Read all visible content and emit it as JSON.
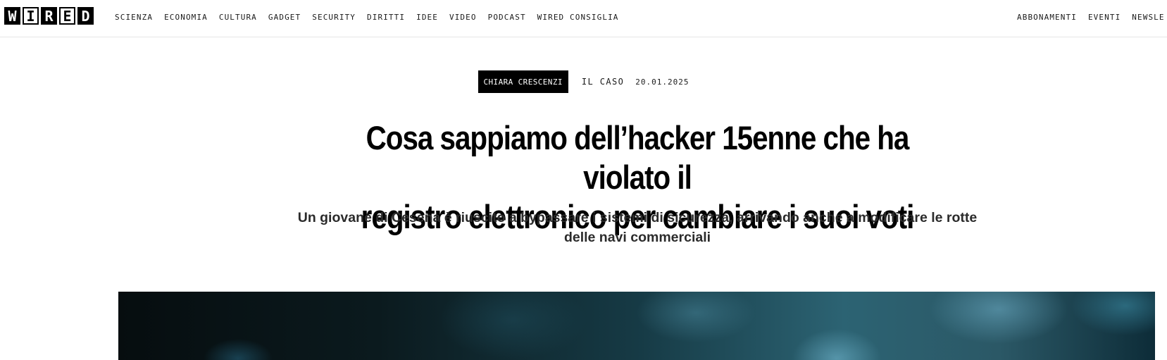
{
  "brand": {
    "letters": [
      "W",
      "I",
      "R",
      "E",
      "D"
    ]
  },
  "nav": {
    "left": [
      "SCIENZA",
      "ECONOMIA",
      "CULTURA",
      "GADGET",
      "SECURITY",
      "DIRITTI",
      "IDEE",
      "VIDEO",
      "PODCAST",
      "WIRED CONSIGLIA"
    ],
    "right": [
      "ABBONAMENTI",
      "EVENTI",
      "NEWSLE"
    ]
  },
  "article": {
    "author": "CHIARA CRESCENZI",
    "section": "IL CASO",
    "date": "20.01.2025",
    "title_line1": "Cosa sappiamo dell’hacker 15enne che ha violato il",
    "title_line2": "registro elettronico per cambiare i suoi voti",
    "dek_line1": "Un giovane di Cesena è riuscito a bypassare i sistemi di sicurezza, arrivando anche a modificare le rotte",
    "dek_line2": "delle navi commerciali"
  },
  "colors": {
    "accent": "#000000",
    "background": "#ffffff",
    "hero_tint": "#2c6373"
  }
}
